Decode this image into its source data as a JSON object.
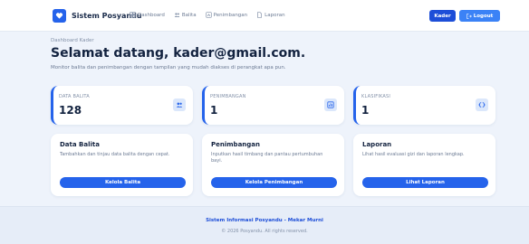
{
  "nav": {
    "brand": "Sistem Posyandu",
    "links": [
      {
        "label": "Dashboard",
        "icon": "dashboard-icon"
      },
      {
        "label": "Balita",
        "icon": "users-icon"
      },
      {
        "label": "Penimbangan",
        "icon": "scale-icon"
      },
      {
        "label": "Laporan",
        "icon": "document-icon"
      }
    ],
    "kader_label": "Kader",
    "logout_label": "Logout"
  },
  "header": {
    "breadcrumb": "Dashboard Kader",
    "welcome": "Selamat datang, kader@gmail.com.",
    "subtitle": "Monitor balita dan penimbangan dengan tampilan yang mudah diakses di perangkat apa pun."
  },
  "stats": [
    {
      "label": "DATA BALITA",
      "value": "128",
      "icon": "users-icon"
    },
    {
      "label": "PENIMBANGAN",
      "value": "1",
      "icon": "chart-icon"
    },
    {
      "label": "KLASIFIKASI",
      "value": "1",
      "icon": "code-icon"
    }
  ],
  "cards": [
    {
      "title": "Data Balita",
      "desc": "Tambahkan dan tinjau data balita dengan cepat.",
      "button": "Kelola Balita"
    },
    {
      "title": "Penimbangan",
      "desc": "Inputkan hasil timbang dan pantau pertumbuhan bayi.",
      "button": "Kelola Penimbangan"
    },
    {
      "title": "Laporan",
      "desc": "Lihat hasil evaluasi gizi dan laporan lengkap.",
      "button": "Lihat Laporan"
    }
  ],
  "footer": {
    "title": "Sistem Informasi Posyandu - Mekar Murni",
    "copyright": "© 2026 Posyandu. All rights reserved."
  },
  "colors": {
    "primary": "#2563eb",
    "dark_blue": "#1d4ed8",
    "background": "#eef3fb"
  }
}
